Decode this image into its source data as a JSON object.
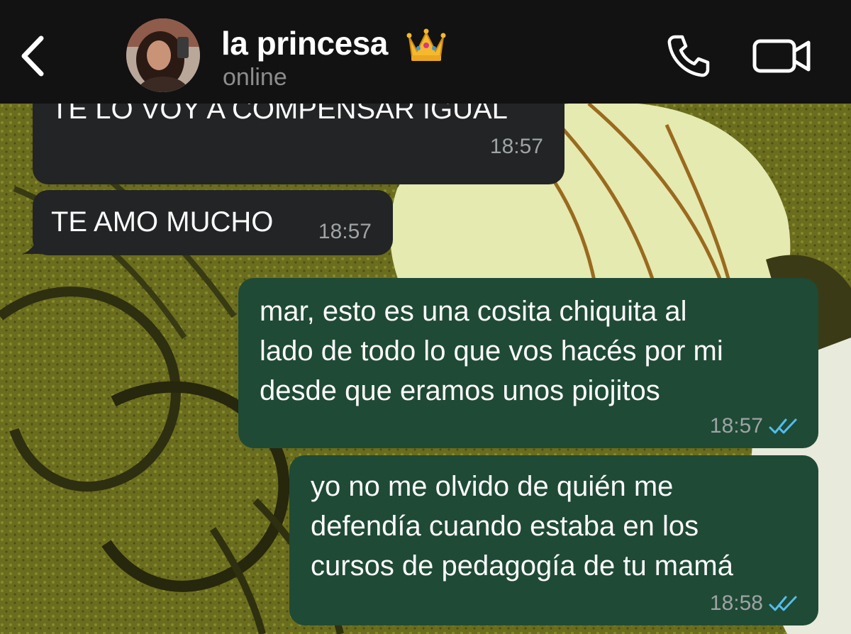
{
  "header": {
    "contact_name": "la princesa",
    "contact_emoji": "crown",
    "status": "online",
    "back_icon": "chevron-left-icon",
    "call_icon": "phone-icon",
    "video_icon": "video-camera-icon"
  },
  "messages": [
    {
      "direction": "incoming",
      "text": "TE LO VOY A COMPENSAR IGUAL",
      "time": "18:57"
    },
    {
      "direction": "incoming",
      "text": "TE AMO MUCHO",
      "time": "18:57"
    },
    {
      "direction": "outgoing",
      "text": "mar, esto es una cosita chiquita al\nlado de todo lo que vos hacés por mi\ndesde que eramos unos piojitos",
      "time": "18:57",
      "read": true
    },
    {
      "direction": "outgoing",
      "text": "yo no me olvido de quién me\ndefendía cuando estaba en los\ncursos de pedagogía de tu mamá",
      "time": "18:58",
      "read": true
    }
  ],
  "colors": {
    "header_bg": "#121212",
    "incoming_bubble": "#232425",
    "outgoing_bubble": "#1f4a36",
    "read_ticks": "#53bdeb",
    "timestamp": "#9ea3a6"
  }
}
